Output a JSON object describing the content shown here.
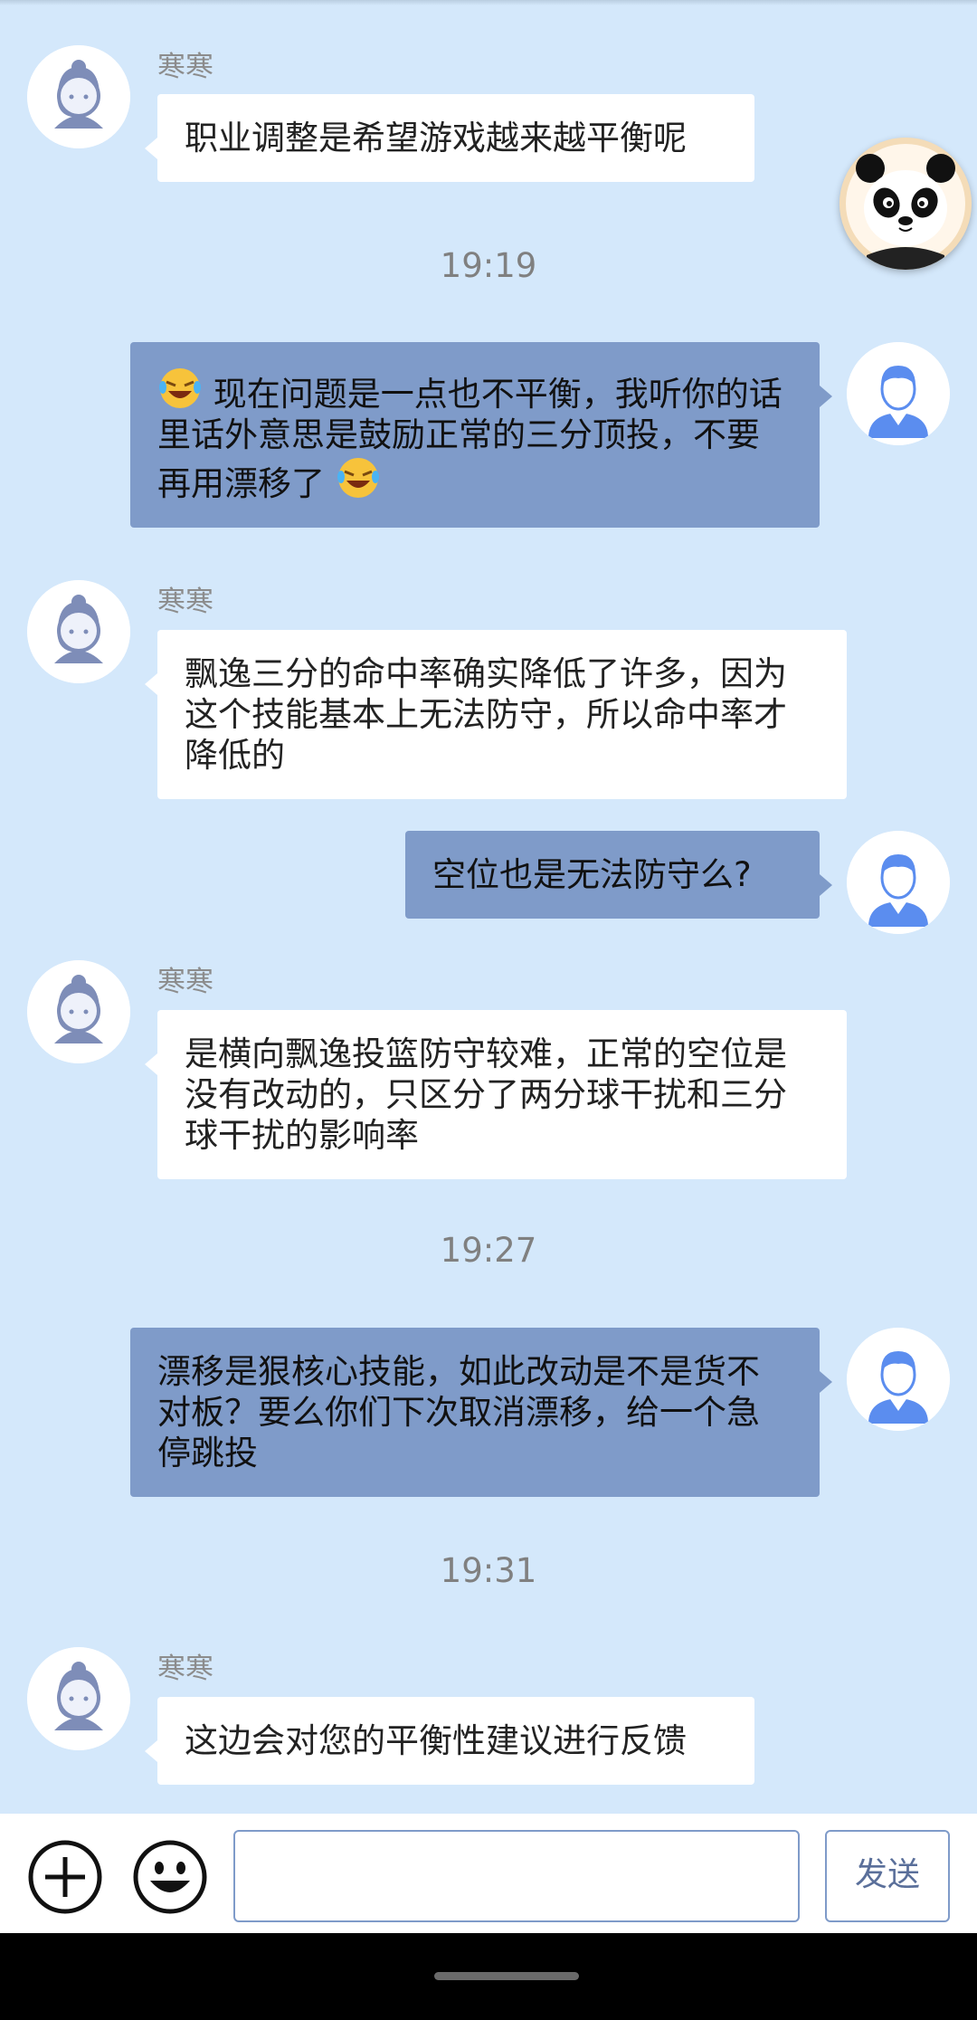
{
  "agent_name": "寒寒",
  "messages": {
    "m1": "职业调整是希望游戏越来越平衡呢",
    "t1": "19:19",
    "m2": "现在问题是一点也不平衡，我听你的话里话外意思是鼓励正常的三分顶投，不要再用漂移了",
    "m3": "飘逸三分的命中率确实降低了许多，因为这个技能基本上无法防守，所以命中率才降低的",
    "m4": "空位也是无法防守么?",
    "m5": "是横向飘逸投篮防守较难，正常的空位是没有改动的，只区分了两分球干扰和三分球干扰的影响率",
    "t2": "19:27",
    "m6": "漂移是狠核心技能，如此改动是不是货不对板？要么你们下次取消漂移，给一个急停跳投",
    "t3": "19:31",
    "m7": "这边会对您的平衡性建议进行反馈"
  },
  "input": {
    "value": "",
    "send_label": "发送"
  },
  "icons": {
    "agent_avatar": "agent-headset-avatar-icon",
    "user_avatar": "user-avatar-icon",
    "panda": "panda-float-icon",
    "emoji": "laughing-crying-emoji-icon",
    "plus": "plus-circle-icon",
    "smile": "smile-icon"
  },
  "colors": {
    "background": "#d4e8fb",
    "user_bubble": "#7f9bc9",
    "agent_bubble": "#ffffff"
  }
}
